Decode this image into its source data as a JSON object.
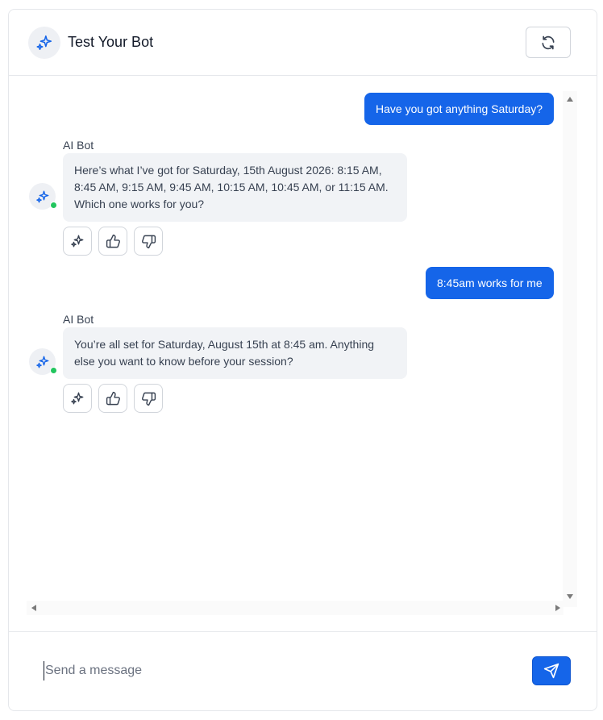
{
  "header": {
    "title": "Test Your Bot",
    "avatar_icon": "sparkles-icon",
    "refresh_icon": "refresh-icon"
  },
  "colors": {
    "accent": "#1565e9",
    "bot_bubble": "#f1f3f6",
    "online": "#22c55e"
  },
  "messages": [
    {
      "role": "user",
      "text": "Have you got anything Saturday?"
    },
    {
      "role": "bot",
      "sender": "AI Bot",
      "text": "Here’s what I’ve got for Saturday, 15th August 2026: 8:15 AM, 8:45 AM, 9:15 AM, 9:45 AM, 10:15 AM, 10:45 AM, or 11:15 AM. Which one works for you?"
    },
    {
      "role": "user",
      "text": "8:45am works for me"
    },
    {
      "role": "bot",
      "sender": "AI Bot",
      "text": "You’re all set for Saturday, August 15th at 8:45 am. Anything else you want to know before your session?"
    }
  ],
  "message_actions": [
    "sparkles-icon",
    "thumbs-up-icon",
    "thumbs-down-icon"
  ],
  "composer": {
    "placeholder": "Send a message",
    "value": "",
    "send_icon": "send-icon"
  }
}
